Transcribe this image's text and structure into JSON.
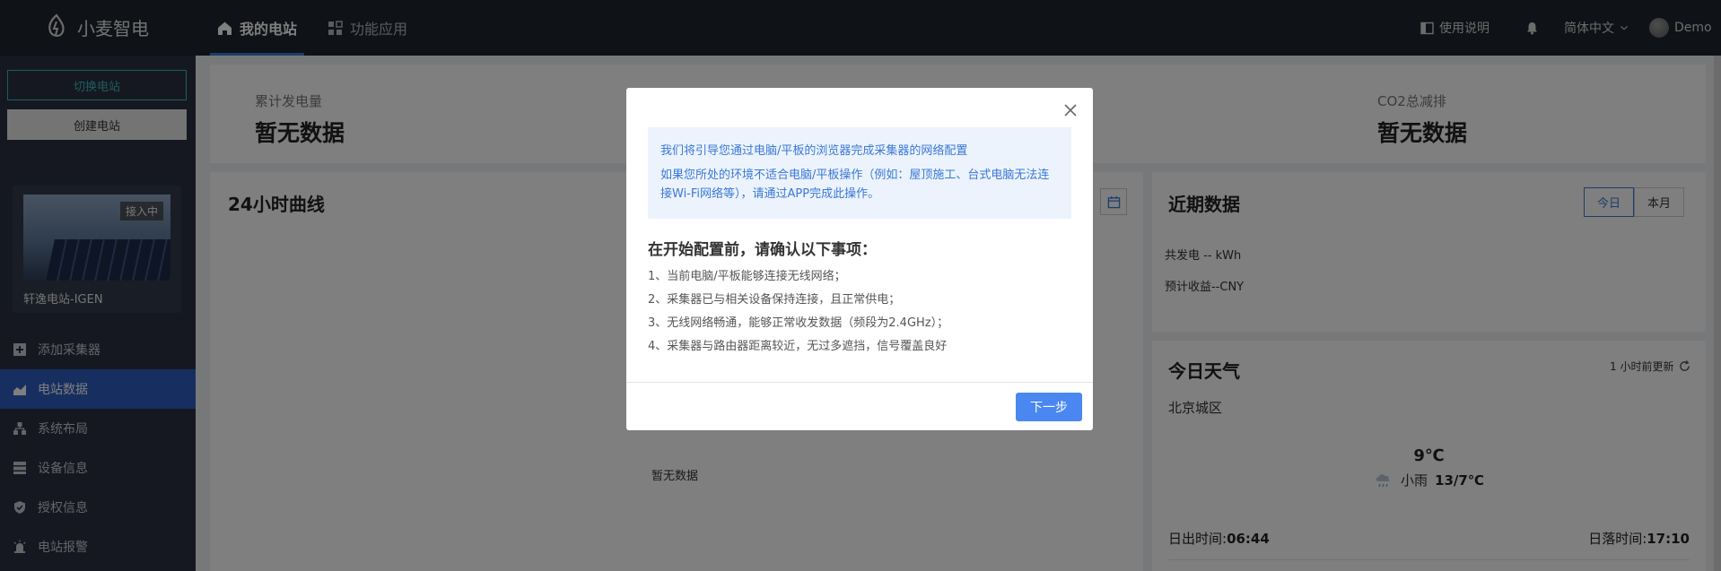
{
  "app": {
    "name": "小麦智电"
  },
  "nav": {
    "tabs": [
      {
        "label": "我的电站",
        "active": true
      },
      {
        "label": "功能应用",
        "active": false
      }
    ]
  },
  "header": {
    "manual": "使用说明",
    "language": "简体中文",
    "user": "Demo"
  },
  "sidebar": {
    "switch_station": "切换电站",
    "create_station": "创建电站",
    "station": {
      "name": "轩逸电站-IGEN",
      "status": "接入中"
    },
    "menu": [
      {
        "label": "添加采集器",
        "icon": "plus-square-icon",
        "active": false
      },
      {
        "label": "电站数据",
        "icon": "chart-icon",
        "active": true
      },
      {
        "label": "系统布局",
        "icon": "layout-icon",
        "active": false
      },
      {
        "label": "设备信息",
        "icon": "device-icon",
        "active": false
      },
      {
        "label": "授权信息",
        "icon": "shield-icon",
        "active": false
      },
      {
        "label": "电站报警",
        "icon": "alarm-icon",
        "active": false
      }
    ]
  },
  "stats": {
    "total_gen": {
      "label": "累计发电量",
      "value": "暂无数据"
    },
    "co2": {
      "label": "CO2总减排",
      "value": "暂无数据"
    }
  },
  "curve": {
    "title": "24小时曲线",
    "empty": "暂无数据"
  },
  "recent": {
    "title": "近期数据",
    "tabs": [
      "今日",
      "本月"
    ],
    "generation": "共发电 -- kWh",
    "income": "预计收益--CNY"
  },
  "weather": {
    "title": "今日天气",
    "updated": "1 小时前更新",
    "city": "北京城区",
    "temp": "9℃",
    "condition": "小雨",
    "range": "13/7℃",
    "sunrise_label": "日出时间:",
    "sunrise": "06:44",
    "sunset_label": "日落时间:",
    "sunset": "17:10"
  },
  "modal": {
    "notice_1": "我们将引导您通过电脑/平板的浏览器完成采集器的网络配置",
    "notice_2": "如果您所处的环境不适合电脑/平板操作（例如：屋顶施工、台式电脑无法连接Wi-Fi网络等），请通过APP完成此操作。",
    "heading": "在开始配置前，请确认以下事项：",
    "steps": [
      "1、当前电脑/平板能够连接无线网络；",
      "2、采集器已与相关设备保持连接，且正常供电；",
      "3、无线网络畅通，能够正常收发数据（频段为2.4GHz）；",
      "4、采集器与路由器距离较近，无过多遮挡，信号覆盖良好"
    ],
    "next": "下一步"
  }
}
